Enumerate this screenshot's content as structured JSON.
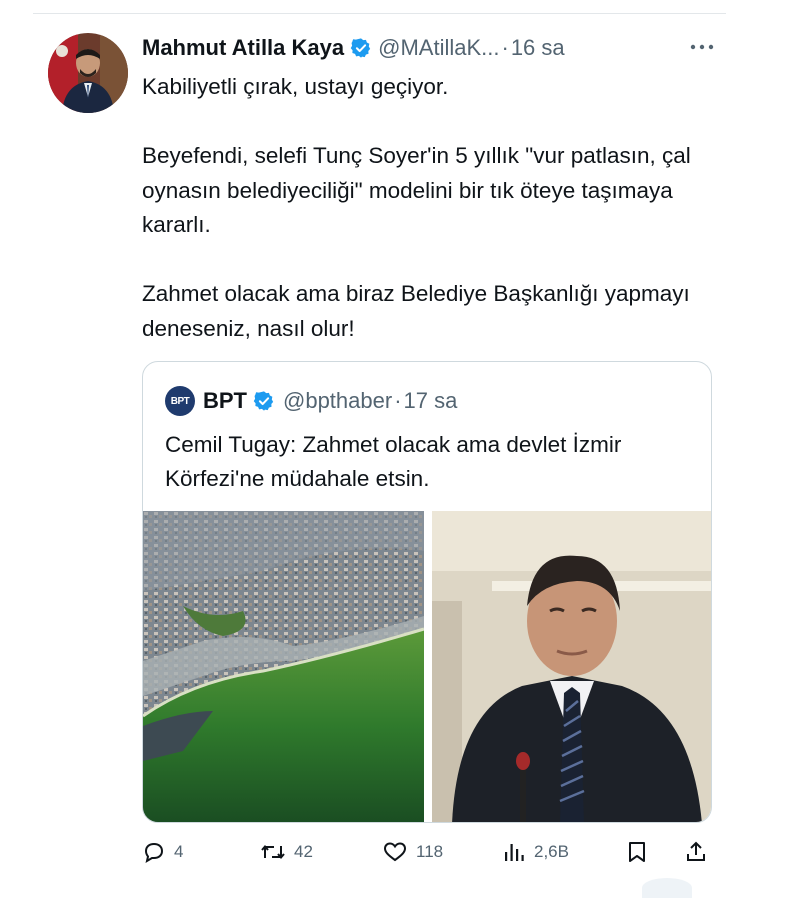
{
  "tweet": {
    "author": {
      "display_name": "Mahmut Atilla Kaya",
      "handle": "@MAtillaK...",
      "verified": true
    },
    "separator": "·",
    "time": "16 sa",
    "text": {
      "line1": "Kabiliyetli çırak, ustayı geçiyor.",
      "para2": "Beyefendi, selefi Tunç Soyer'in 5 yıllık \"vur patlasın, çal oynasın belediyeciliği\" modelini bir tık öteye taşımaya kararlı.",
      "para3": "Zahmet olacak ama biraz Belediye Başkanlığı yapmayı deneseniz, nasıl olur!"
    }
  },
  "quote": {
    "avatar_text": "BPT",
    "display_name": "BPT",
    "handle": "@bpthaber",
    "separator": "·",
    "time": "17 sa",
    "text": "Cemil Tugay: Zahmet olacak ama devlet İzmir Körfezi'ne müdahale etsin."
  },
  "actions": {
    "reply_count": "4",
    "retweet_count": "42",
    "like_count": "118",
    "views_count": "2,6B"
  },
  "icons": {
    "verified": "verified-badge-icon",
    "more": "more-horizontal-icon",
    "reply": "reply-icon",
    "retweet": "retweet-icon",
    "like": "heart-icon",
    "views": "views-icon",
    "bookmark": "bookmark-icon",
    "share": "share-icon"
  },
  "colors": {
    "text_primary": "#0f1419",
    "text_secondary": "#536471",
    "verified_blue": "#1d9bf0",
    "border": "#cfd9de"
  }
}
